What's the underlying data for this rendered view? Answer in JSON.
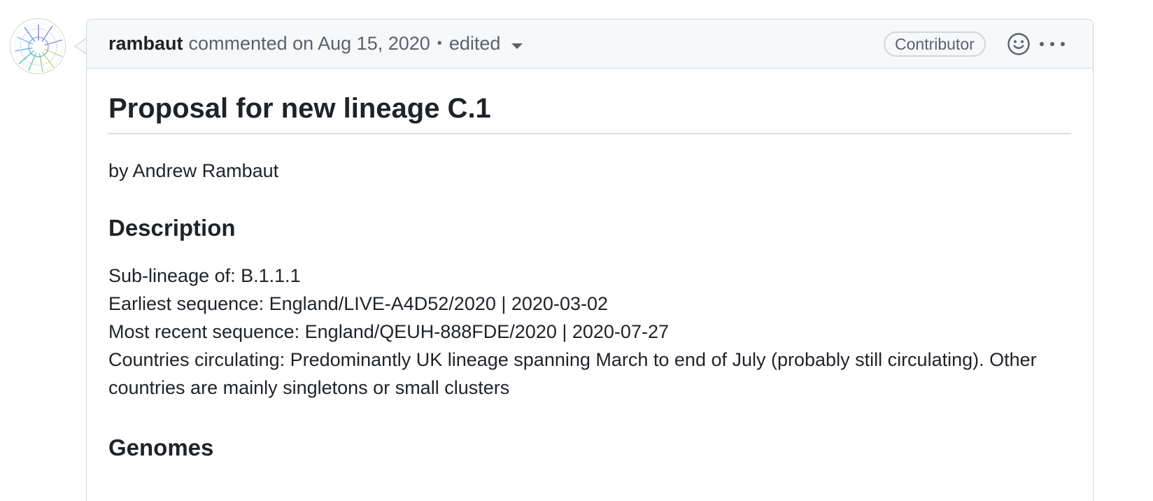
{
  "comment": {
    "author": "rambaut",
    "action": "commented on Aug 15, 2020",
    "separator": "•",
    "edited_label": "edited",
    "role_badge": "Contributor",
    "icons": {
      "reaction": "smiley-icon",
      "more": "kebab-horizontal-icon",
      "edited_menu": "triangle-down-icon"
    }
  },
  "body": {
    "title": "Proposal for new lineage C.1",
    "byline": "by Andrew Rambaut",
    "description_heading": "Description",
    "description_lines": [
      "Sub-lineage of: B.1.1.1",
      "Earliest sequence: England/LIVE-A4D52/2020 | 2020-03-02",
      "Most recent sequence: England/QEUH-888FDE/2020 | 2020-07-27",
      "Countries circulating: Predominantly UK lineage spanning March to end of July (probably still circulating). Other countries are mainly singletons or small clusters"
    ],
    "genomes_heading": "Genomes"
  },
  "colors": {
    "header_bg": "#f6f8fa",
    "border": "#d0d7de",
    "text": "#1f2328",
    "muted": "#59636e"
  }
}
